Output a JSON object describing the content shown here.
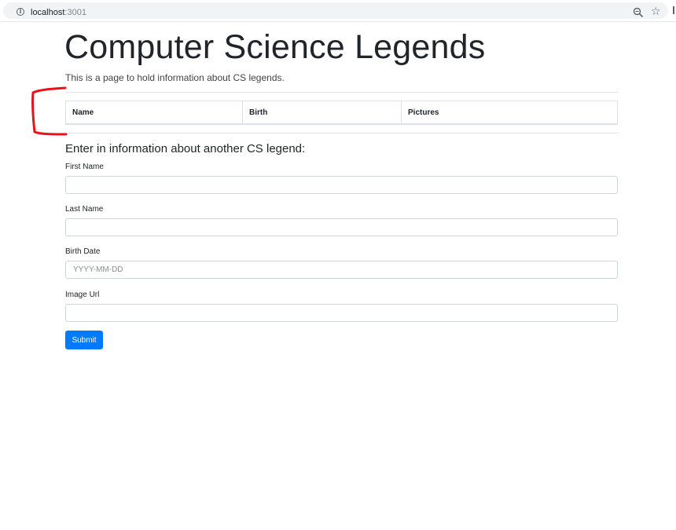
{
  "browser": {
    "url_host": "localhost",
    "url_port": ":3001",
    "info_icon": "info-icon",
    "zoom_icon": "zoom-icon",
    "bookmark_icon": "star-icon"
  },
  "page": {
    "title": "Computer Science Legends",
    "lead": "This is a page to hold information about CS legends."
  },
  "table": {
    "headers": [
      "Name",
      "Birth",
      "Pictures"
    ],
    "rows": []
  },
  "form": {
    "heading": "Enter in information about another CS legend:",
    "first_name": {
      "label": "First Name",
      "value": "",
      "placeholder": ""
    },
    "last_name": {
      "label": "Last Name",
      "value": "",
      "placeholder": ""
    },
    "birth_date": {
      "label": "Birth Date",
      "value": "",
      "placeholder": "YYYY-MM-DD"
    },
    "image_url": {
      "label": "Image Url",
      "value": "",
      "placeholder": ""
    },
    "submit_label": "Submit"
  },
  "colors": {
    "primary": "#007bff",
    "annotation": "#e8121a"
  }
}
